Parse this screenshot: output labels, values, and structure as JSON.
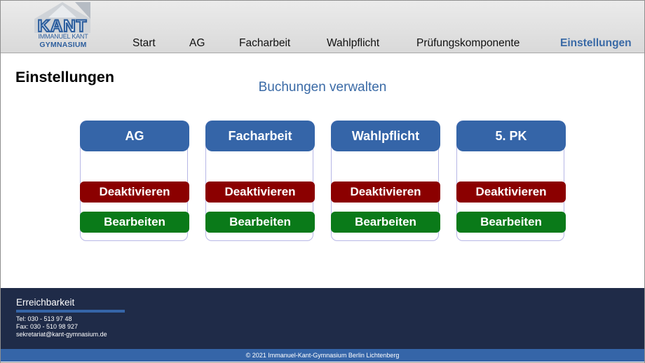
{
  "logo": {
    "line1": "IMMANUEL KANT",
    "line2": "GYMNASIUM"
  },
  "nav": [
    {
      "label": "Start"
    },
    {
      "label": "AG"
    },
    {
      "label": "Facharbeit"
    },
    {
      "label": "Wahlpflicht"
    },
    {
      "label": "Prüfungskomponente"
    },
    {
      "label": "Einstellungen",
      "active": true
    }
  ],
  "page": {
    "title": "Einstellungen",
    "subtitle": "Buchungen verwalten"
  },
  "cards": [
    {
      "title": "AG",
      "deactivate": "Deaktivieren",
      "edit": "Bearbeiten"
    },
    {
      "title": "Facharbeit",
      "deactivate": "Deaktivieren",
      "edit": "Bearbeiten"
    },
    {
      "title": "Wahlpflicht",
      "deactivate": "Deaktivieren",
      "edit": "Bearbeiten"
    },
    {
      "title": "5. PK",
      "deactivate": "Deaktivieren",
      "edit": "Bearbeiten"
    }
  ],
  "footer": {
    "title": "Erreichbarkeit",
    "tel": "Tel:  030 - 513 97 48",
    "fax": "Fax: 030 - 510 98 927",
    "email": "sekretariat@kant-gymnasium.de",
    "copyright": "© 2021 Immanuel-Kant-Gymnasium Berlin Lichtenberg"
  },
  "colors": {
    "brand": "#3565a8",
    "deactivate": "#8b0000",
    "edit": "#0a7a19",
    "footer": "#1f2b48"
  }
}
